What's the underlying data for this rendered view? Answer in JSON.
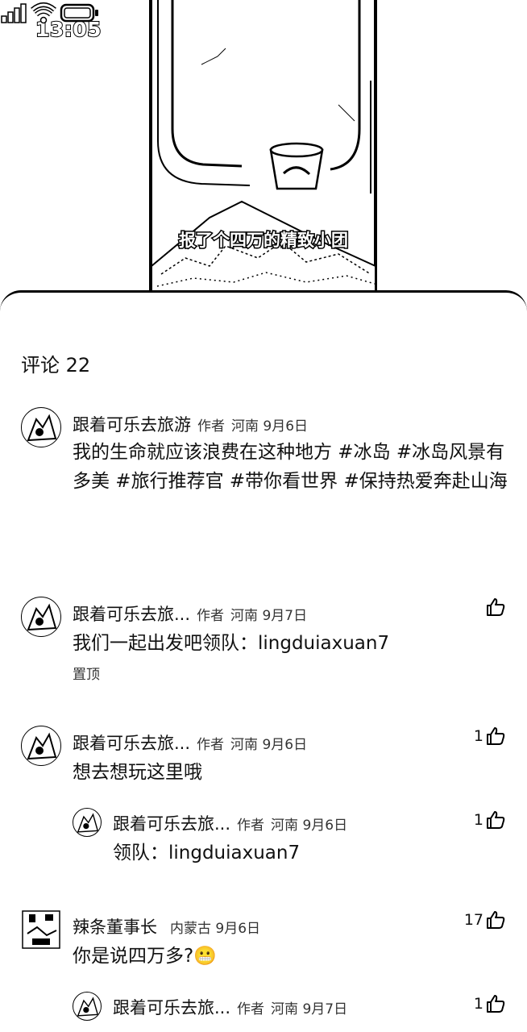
{
  "status_bar": {
    "time": "13:05"
  },
  "video": {
    "subtitle": "报了个四万的精致小团"
  },
  "comments_header": {
    "label": "评论 22"
  },
  "comments": [
    {
      "author": "跟着可乐去旅游",
      "tag": "作者",
      "location": "河南",
      "date": "9月6日",
      "text": "我的生命就应该浪费在这种地方 #冰岛 #冰岛风景有多美 #旅行推荐官 #带你看世界 #保持热爱奔赴山海",
      "likes": ""
    },
    {
      "author": "跟着可乐去旅...",
      "tag": "作者",
      "location": "河南",
      "date": "9月7日",
      "text": "我们一起出发吧领队：lingduiaxuan7",
      "pinned": "置顶",
      "likes": ""
    },
    {
      "author": "跟着可乐去旅...",
      "tag": "作者",
      "location": "河南",
      "date": "9月6日",
      "text": "想去想玩这里哦",
      "likes": "1"
    },
    {
      "author": "跟着可乐去旅...",
      "tag": "作者",
      "location": "河南",
      "date": "9月6日",
      "text": "领队：lingduiaxuan7",
      "likes": "1"
    },
    {
      "author": "辣条董事长",
      "tag": "",
      "location": "内蒙古",
      "date": "9月6日",
      "text": "你是说四万多?😬",
      "likes": "17"
    },
    {
      "author": "跟着可乐去旅...",
      "tag": "作者",
      "location": "河南",
      "date": "9月7日",
      "text": "",
      "likes": "1"
    }
  ]
}
